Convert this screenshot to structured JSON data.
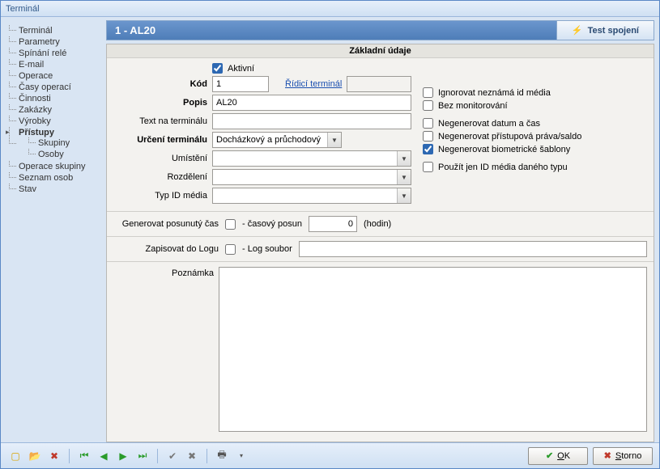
{
  "window_title": "Terminál",
  "header": {
    "title": "1  -  AL20",
    "test_button": "Test spojení"
  },
  "sidebar": {
    "items": [
      "Terminál",
      "Parametry",
      "Spínání relé",
      "E-mail",
      "Operace",
      "Časy operací",
      "Činnosti",
      "Zakázky",
      "Výrobky",
      "Přístupy",
      "Operace skupiny",
      "Seznam osob",
      "Stav"
    ],
    "pristupy_children": [
      "Skupiny",
      "Osoby"
    ]
  },
  "panel_title": "Základní údaje",
  "form": {
    "aktivni_label": "Aktivní",
    "aktivni_value": true,
    "kod_label": "Kód",
    "kod_value": "1",
    "ridici_link": "Řídicí terminál",
    "ridici_value": "",
    "popis_label": "Popis",
    "popis_value": "AL20",
    "text_term_label": "Text na terminálu",
    "text_term_value": "",
    "urceni_label": "Určení terminálu",
    "urceni_value": "Docházkový a průchodový",
    "umisteni_label": "Umístění",
    "rozdeleni_label": "Rozdělení",
    "typid_label": "Typ ID média"
  },
  "checks": {
    "ignore": {
      "label": "Ignorovat neznámá id média",
      "value": false
    },
    "nomonitor": {
      "label": "Bez monitorování",
      "value": false
    },
    "nodate": {
      "label": "Negenerovat datum a čas",
      "value": false
    },
    "noaccess": {
      "label": "Negenerovat přístupová práva/saldo",
      "value": false
    },
    "nobio": {
      "label": "Negenerovat biometrické šablony",
      "value": true
    },
    "onlytype": {
      "label": "Použít jen ID média daného typu",
      "value": false
    }
  },
  "shift": {
    "label": "Generovat posunutý čas",
    "sublabel": "- časový posun",
    "value": "0",
    "unit": "(hodin)"
  },
  "log": {
    "label": "Zapisovat do Logu",
    "sublabel": "- Log soubor",
    "value": ""
  },
  "note": {
    "label": "Poznámka",
    "value": ""
  },
  "footer": {
    "ok": "OK",
    "storno": "Storno"
  }
}
